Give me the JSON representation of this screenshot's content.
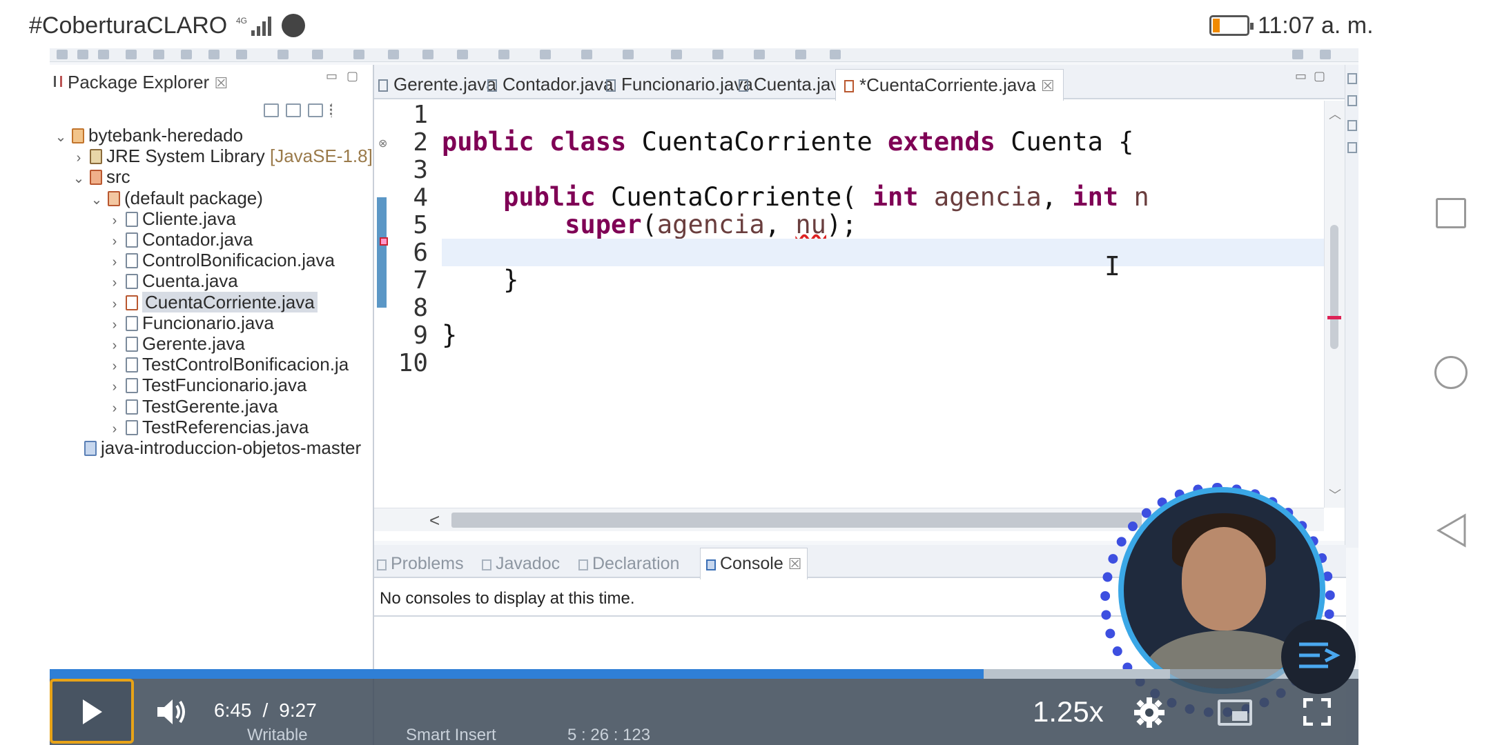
{
  "statusbar": {
    "carrier": "#CoberturaCLARO",
    "network": "4G",
    "time": "11:07 a. m.",
    "battery_color": "#f08a00"
  },
  "package_explorer": {
    "title": "Package Explorer",
    "close": "☒",
    "tree": [
      {
        "label": "bytebank-heredado",
        "extra": "",
        "twisty": "⌄",
        "icon": "project-icon"
      },
      {
        "label": "JRE System Library",
        "extra": "[JavaSE-1.8]",
        "twisty": "›",
        "icon": "library-icon"
      },
      {
        "label": "src",
        "extra": "",
        "twisty": "⌄",
        "icon": "src-folder-icon"
      },
      {
        "label": "(default package)",
        "extra": "",
        "twisty": "⌄",
        "icon": "package-icon"
      },
      {
        "label": "Cliente.java",
        "extra": "",
        "twisty": "›",
        "icon": "java-file-icon"
      },
      {
        "label": "Contador.java",
        "extra": "",
        "twisty": "›",
        "icon": "java-file-icon"
      },
      {
        "label": "ControlBonificacion.java",
        "extra": "",
        "twisty": "›",
        "icon": "java-file-icon"
      },
      {
        "label": "Cuenta.java",
        "extra": "",
        "twisty": "›",
        "icon": "java-file-icon"
      },
      {
        "label": "CuentaCorriente.java",
        "extra": "",
        "twisty": "›",
        "icon": "java-file-error-icon"
      },
      {
        "label": "Funcionario.java",
        "extra": "",
        "twisty": "›",
        "icon": "java-file-icon"
      },
      {
        "label": "Gerente.java",
        "extra": "",
        "twisty": "›",
        "icon": "java-file-icon"
      },
      {
        "label": "TestControlBonificacion.ja",
        "extra": "",
        "twisty": "›",
        "icon": "java-file-icon"
      },
      {
        "label": "TestFuncionario.java",
        "extra": "",
        "twisty": "›",
        "icon": "java-file-icon"
      },
      {
        "label": "TestGerente.java",
        "extra": "",
        "twisty": "›",
        "icon": "java-file-icon"
      },
      {
        "label": "TestReferencias.java",
        "extra": "",
        "twisty": "›",
        "icon": "java-file-icon"
      },
      {
        "label": "java-introduccion-objetos-master",
        "extra": "",
        "twisty": "",
        "icon": "folder-icon"
      }
    ]
  },
  "editor": {
    "tabs": [
      "Gerente.java",
      "Contador.java",
      "Funcionario.java",
      "Cuenta.java",
      "*CuentaCorriente.java"
    ],
    "active_tab_close": "☒",
    "line_numbers": [
      "1",
      "2",
      "3",
      "4",
      "5",
      "6",
      "7",
      "8",
      "9",
      "10"
    ],
    "code": {
      "l2_kw1": "public",
      "l2_kw2": "class",
      "l2_name": "CuentaCorriente",
      "l2_kw3": "extends",
      "l2_rest": "Cuenta {",
      "l4_kw1": "public",
      "l4_name": "CuentaCorriente(",
      "l4_kw2": "int",
      "l4_p1": "agencia",
      "l4_comma": ",",
      "l4_kw3": "int",
      "l4_p2": "n",
      "l5_kw": "super",
      "l5_open": "(",
      "l5_p1": "agencia",
      "l5_comma": ", ",
      "l5_p2": "nu",
      "l5_close": ");",
      "l7": "}",
      "l9": "}"
    },
    "hscroll_left": "<"
  },
  "console": {
    "tabs": [
      "Problems",
      "Javadoc",
      "Declaration",
      "Console"
    ],
    "close": "☒",
    "message": "No consoles to display at this time."
  },
  "eclipse_status": {
    "writable": "Writable",
    "insert_mode": "Smart Insert",
    "position": "5 : 26 : 123"
  },
  "player": {
    "current_time": "6:45",
    "separator": "/",
    "duration": "9:27",
    "speed": "1.25x",
    "progress_fraction": 0.7136,
    "accent": "#2f7fd6"
  }
}
